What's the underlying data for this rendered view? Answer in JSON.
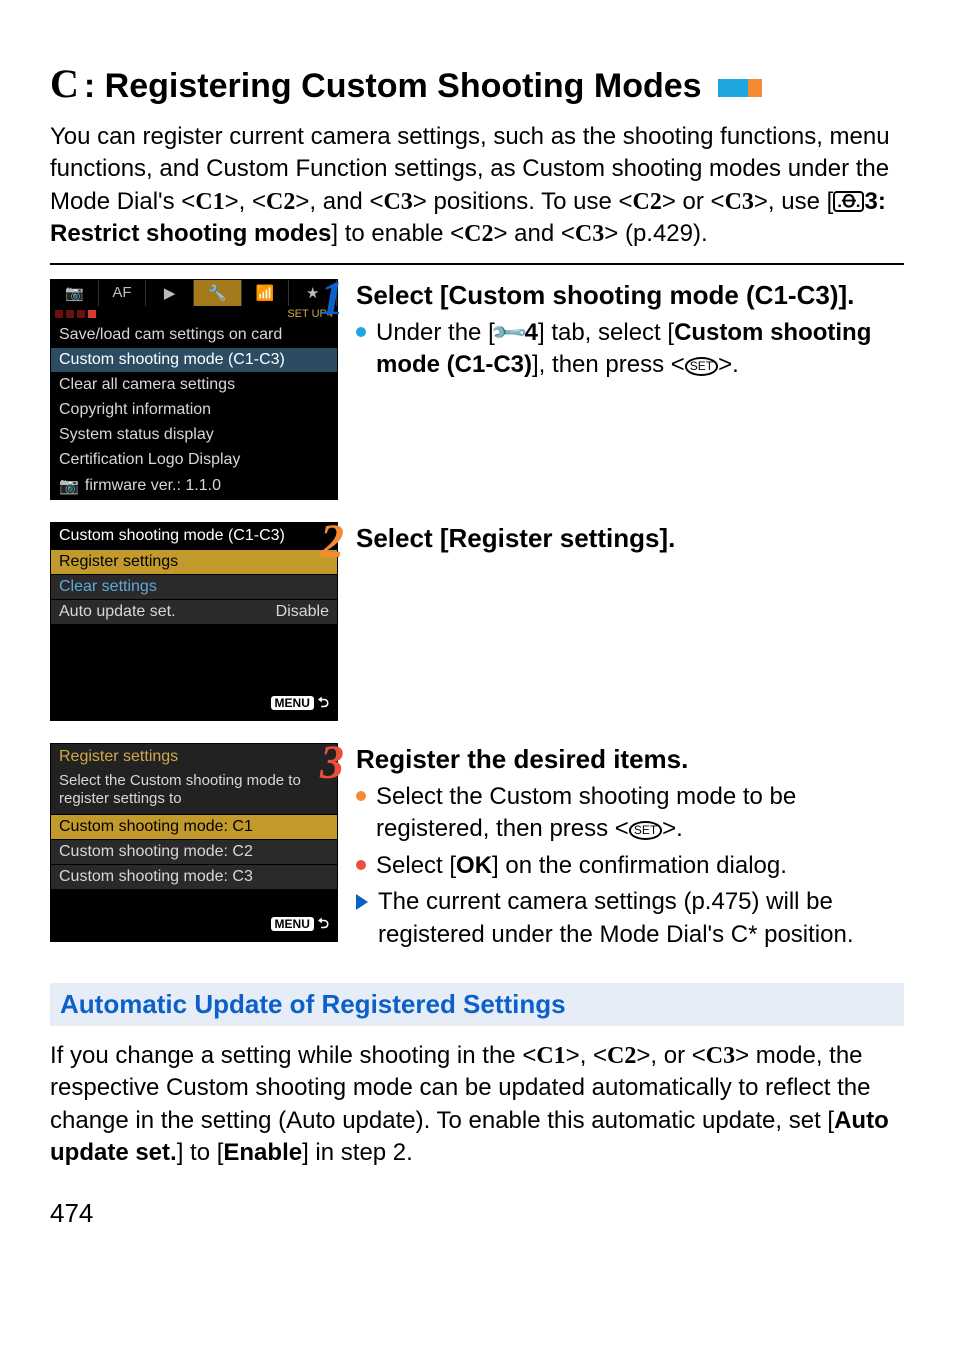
{
  "title": {
    "prefix": "C",
    "text": ": Registering Custom Shooting Modes"
  },
  "intro": {
    "l1": "You can register current camera settings, such as the shooting functions, menu functions, and Custom Function settings, as Custom shooting modes under the Mode Dial's <",
    "c1": "C1",
    "mid1": ">, <",
    "c2": "C2",
    "mid2": ">, and <",
    "c3": "C3",
    "mid3": "> positions. To use <",
    "c2b": "C2",
    "mid4": "> or <",
    "c3b": "C3",
    "mid5": ">, use [",
    "restrict_num": "3: ",
    "restrict": "Restrict shooting modes",
    "mid6": "] to enable <",
    "c2c": "C2",
    "mid7": "> and <",
    "c3c": "C3",
    "mid8": "> (p.429)."
  },
  "shot1": {
    "tabs": {
      "t1": "📷",
      "t2": "AF",
      "t3": "▶",
      "t4": "🔧",
      "t5": "📶",
      "t6": "★"
    },
    "setup_label": "SET UP4",
    "rows": {
      "r1": "Save/load cam settings on card",
      "r2": "Custom shooting mode (C1-C3)",
      "r3": "Clear all camera settings",
      "r4": "Copyright information",
      "r5": "System status display",
      "r6": "Certification Logo Display",
      "r7": "firmware ver.: 1.1.0"
    }
  },
  "step1": {
    "num": "1",
    "heading": "Select [Custom shooting mode (C1-C3)].",
    "b1_pre": "Under the [",
    "b1_wrenchnum": "4",
    "b1_mid": "] tab, select [",
    "b1_bold": "Custom shooting mode (C1-C3)",
    "b1_post": "], then press <",
    "b1_end": ">."
  },
  "shot2": {
    "title": "Custom shooting mode (C1-C3)",
    "r1": "Register settings",
    "r2": "Clear settings",
    "r3a": "Auto update set.",
    "r3b": "Disable",
    "menu": "MENU"
  },
  "step2": {
    "num": "2",
    "heading": "Select [Register settings]."
  },
  "shot3": {
    "title": "Register settings",
    "sub": "Select the Custom shooting mode to register settings to",
    "r1": "Custom shooting mode: C1",
    "r2": "Custom shooting mode: C2",
    "r3": "Custom shooting mode: C3",
    "menu": "MENU"
  },
  "step3": {
    "num": "3",
    "heading": "Register the desired items.",
    "b1_a": "Select the Custom shooting mode to be registered, then press <",
    "b1_b": ">.",
    "b2_a": "Select [",
    "b2_bold": "OK",
    "b2_b": "] on the confirmation dialog.",
    "b3": "The current camera settings (p.475) will be registered under the Mode Dial's C* position."
  },
  "sub_heading": "Automatic Update of Registered Settings",
  "auto": {
    "a": "If you change a setting while shooting in the <",
    "c1": "C1",
    "b": ">, <",
    "c2": "C2",
    "c": ">, or <",
    "c3": "C3",
    "d": "> mode, the respective Custom shooting mode can be updated automatically to reflect the change in the setting (Auto update). To enable this automatic update, set [",
    "bold": "Auto update set.",
    "e": "] to [",
    "bold2": "Enable",
    "f": "] in step 2."
  },
  "page_num": "474"
}
